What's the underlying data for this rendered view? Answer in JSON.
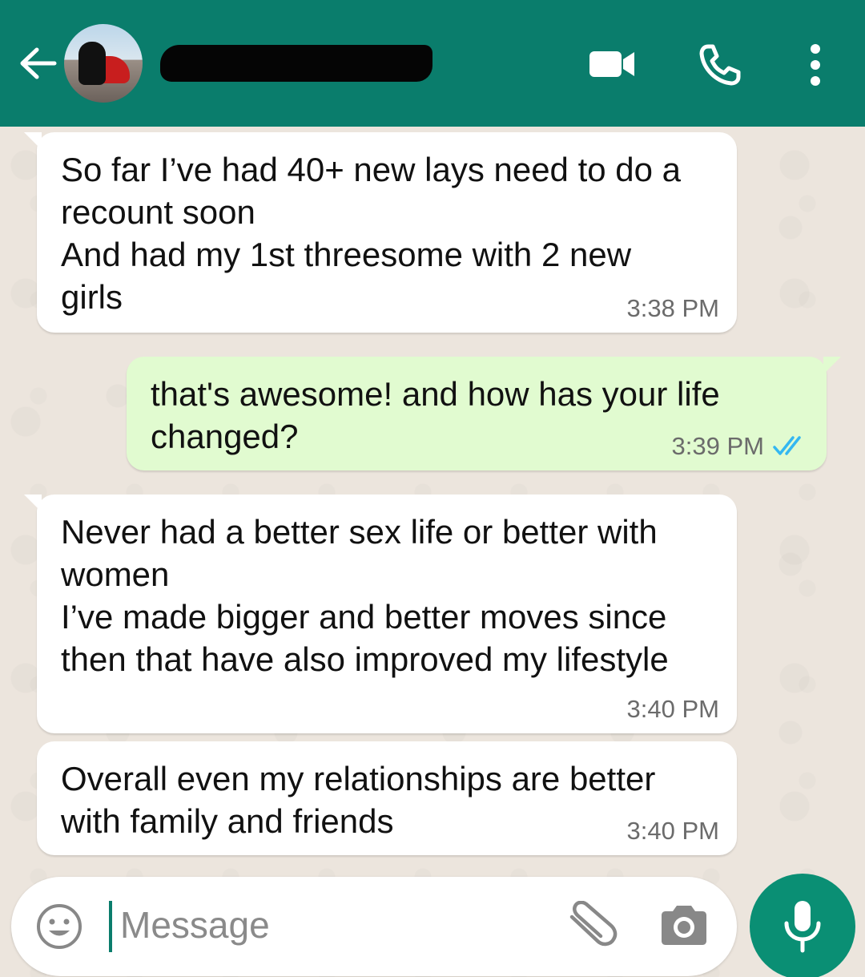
{
  "header": {
    "back_icon": "arrow-left-icon",
    "contact_name": "",
    "actions": [
      "video-call-icon",
      "voice-call-icon",
      "more-options-icon"
    ],
    "colors": {
      "bar": "#0a7d6c"
    }
  },
  "messages": [
    {
      "direction": "incoming",
      "text": "So far I’ve had 40+ new lays need to do a\nrecount soon\nAnd had my 1st threesome with 2 new\ngirls",
      "time": "3:38 PM"
    },
    {
      "direction": "outgoing",
      "text": "that's awesome! and how has your life\nchanged?",
      "time": "3:39 PM",
      "status": "read"
    },
    {
      "direction": "incoming",
      "text": "Never had a better sex life or better with\nwomen\nI’ve made bigger and better moves since\nthen that have also improved my lifestyle",
      "time": "3:40 PM"
    },
    {
      "direction": "incoming",
      "text": "Overall even my relationships are better\nwith family and friends",
      "time": "3:40 PM"
    }
  ],
  "composer": {
    "placeholder": "Message",
    "icons": [
      "emoji-icon",
      "attach-icon",
      "camera-icon",
      "microphone-icon"
    ],
    "colors": {
      "send_button": "#0a8f74",
      "outgoing_bubble": "#e1fbd0",
      "tick_read": "#34b7f1"
    }
  }
}
